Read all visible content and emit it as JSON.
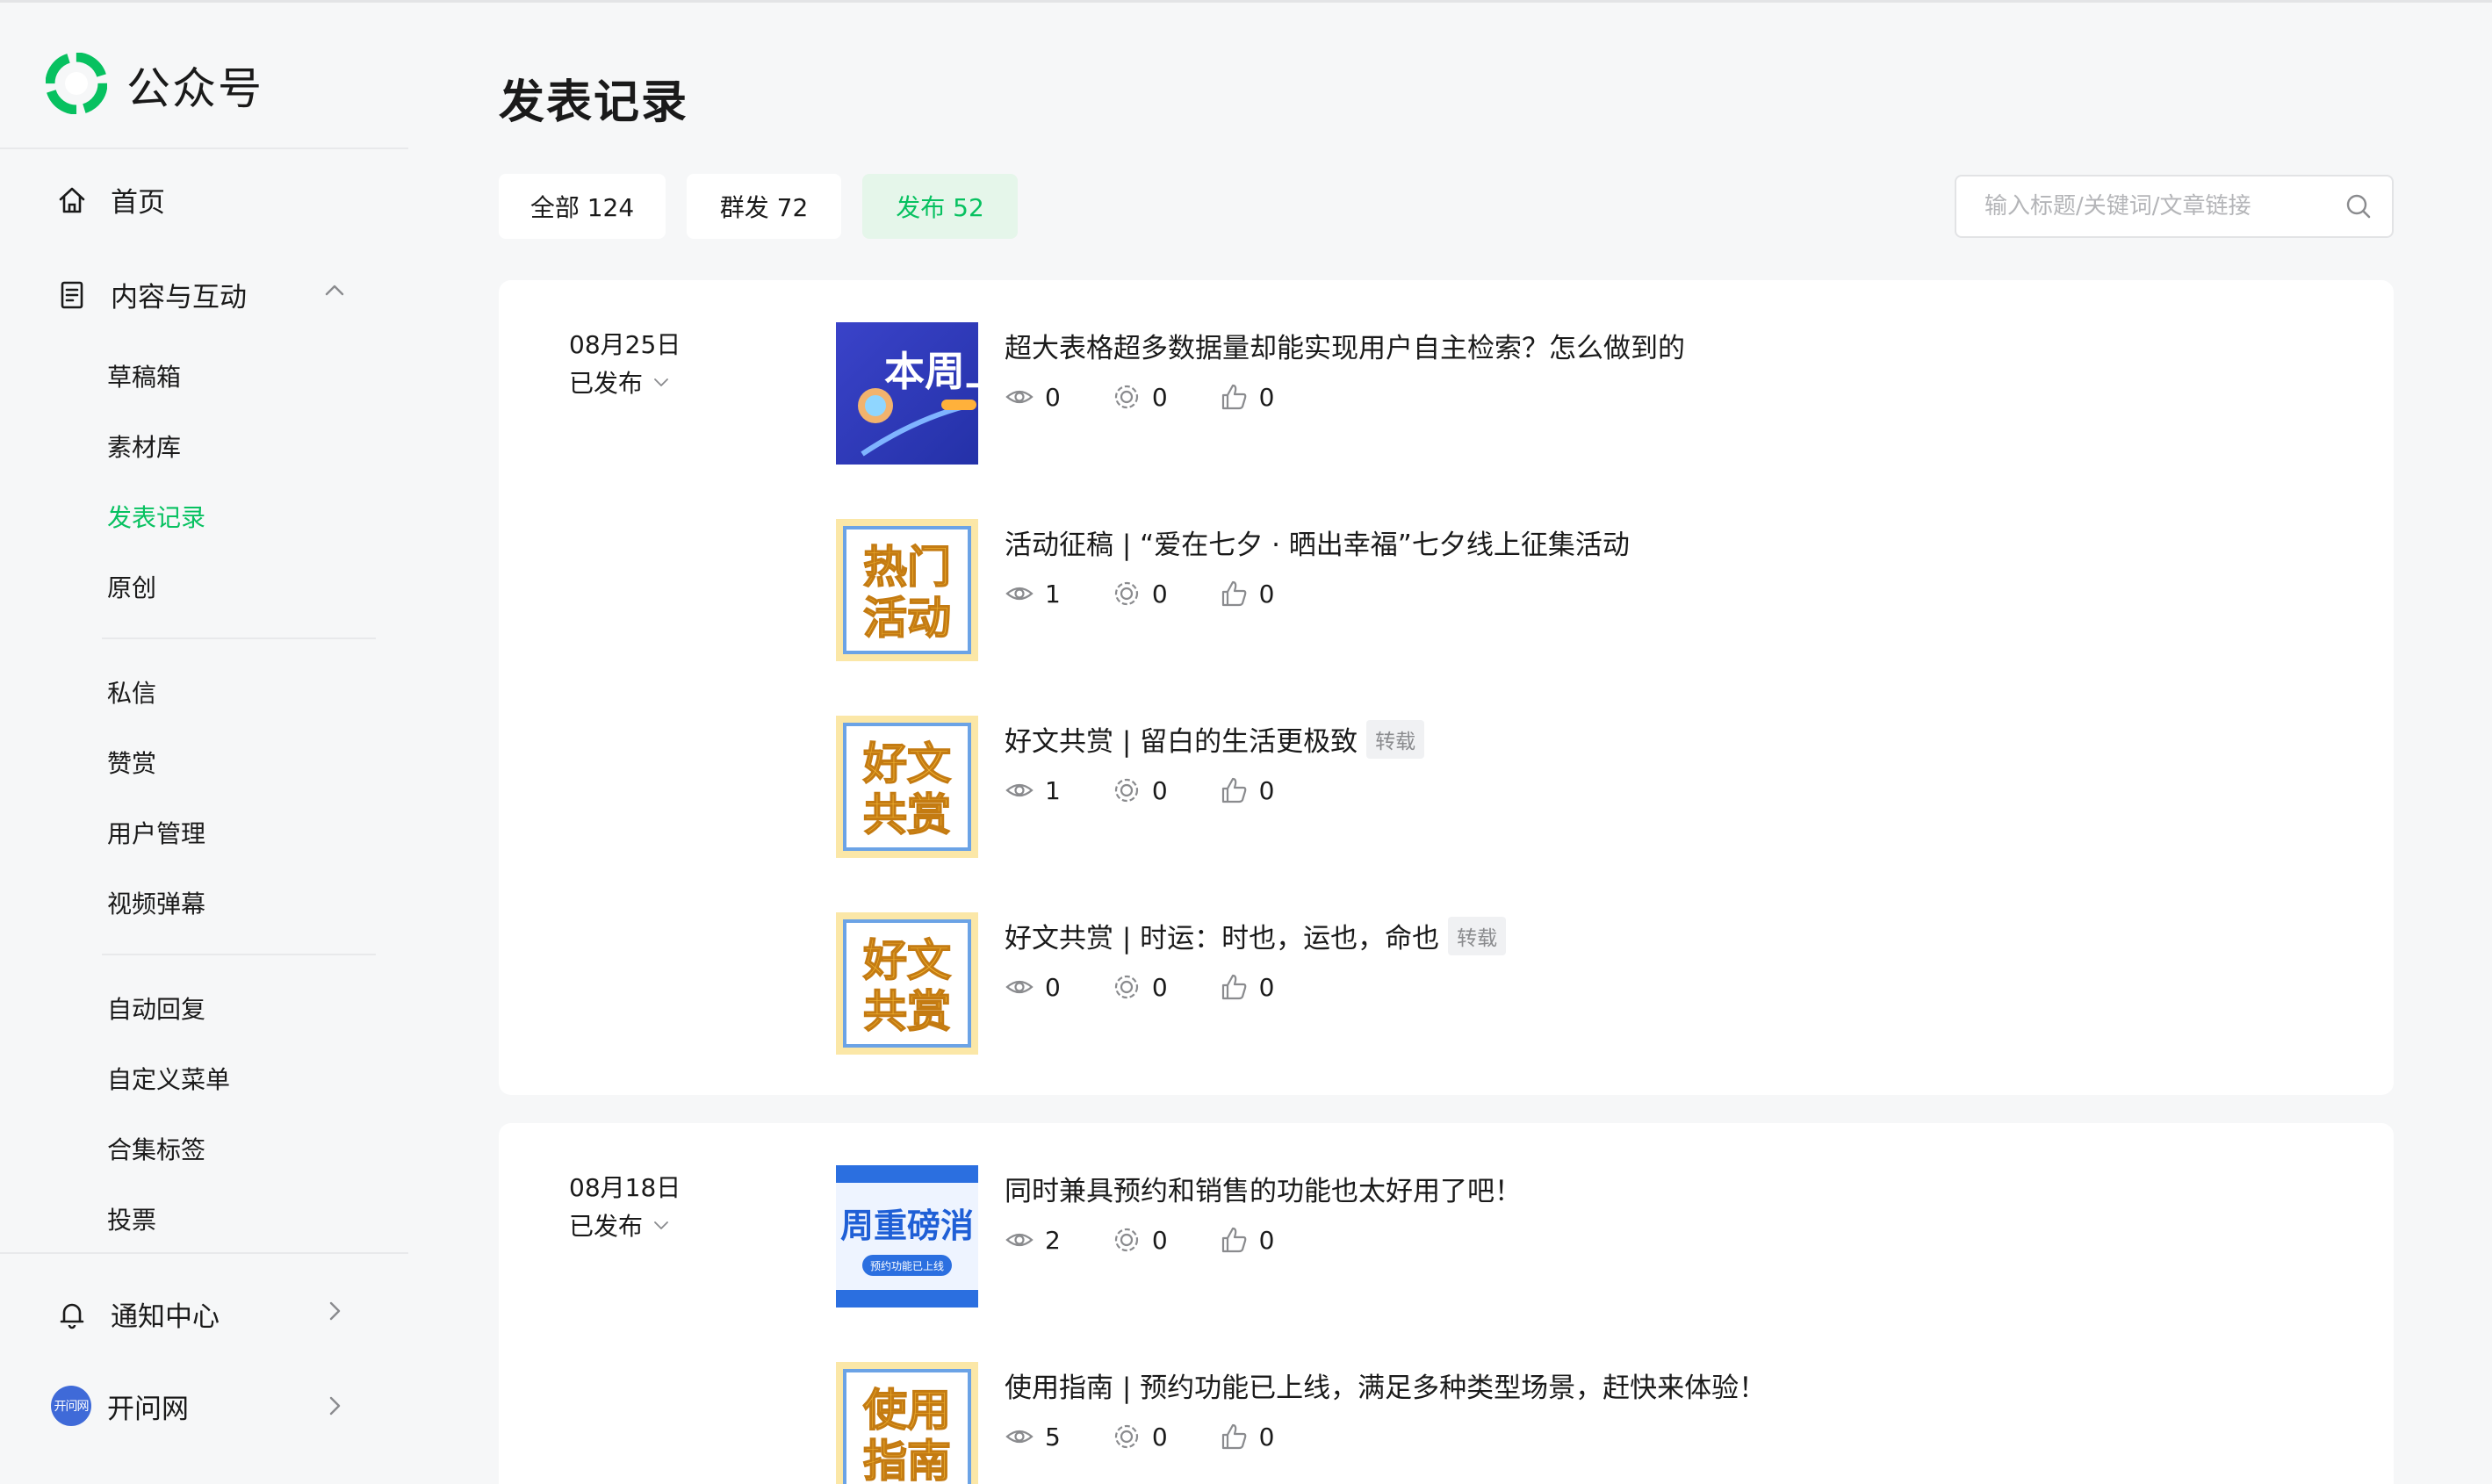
{
  "app": {
    "title": "公众号",
    "brand_color": "#07c160"
  },
  "sidebar": {
    "home": "首页",
    "content_group": "内容与互动",
    "sub_items_1": [
      "草稿箱",
      "素材库",
      "发表记录",
      "原创"
    ],
    "sub_items_2": [
      "私信",
      "赞赏",
      "用户管理",
      "视频弹幕"
    ],
    "sub_items_3": [
      "自动回复",
      "自定义菜单",
      "合集标签",
      "投票"
    ],
    "notifications": "通知中心",
    "account_name": "开问网",
    "account_avatar_text": "开问网"
  },
  "page": {
    "title": "发表记录"
  },
  "tabs": [
    {
      "label": "全部 124"
    },
    {
      "label": "群发 72"
    },
    {
      "label": "发布 52"
    }
  ],
  "search": {
    "placeholder": "输入标题/关键词/文章链接",
    "value": ""
  },
  "groups": [
    {
      "date": "08月25日",
      "status": "已发布",
      "articles": [
        {
          "title": "超大表格超多数据量却能实现用户自主检索？怎么做到的",
          "tag": "",
          "views": "0",
          "shares": "0",
          "likes": "0",
          "thumb": {
            "style": "blue",
            "line1": "本周上",
            "line2": ""
          }
        },
        {
          "title": "活动征稿 | “爱在七夕 · 晒出幸福”七夕线上征集活动",
          "tag": "",
          "views": "1",
          "shares": "0",
          "likes": "0",
          "thumb": {
            "style": "yellow",
            "line1": "热门",
            "line2": "活动"
          }
        },
        {
          "title": "好文共赏 | 留白的生活更极致",
          "tag": "转载",
          "views": "1",
          "shares": "0",
          "likes": "0",
          "thumb": {
            "style": "yellow",
            "line1": "好文",
            "line2": "共赏"
          }
        },
        {
          "title": "好文共赏 | 时运：时也，运也，命也",
          "tag": "转载",
          "views": "0",
          "shares": "0",
          "likes": "0",
          "thumb": {
            "style": "yellow",
            "line1": "好文",
            "line2": "共赏"
          }
        }
      ]
    },
    {
      "date": "08月18日",
      "status": "已发布",
      "articles": [
        {
          "title": "同时兼具预约和销售的功能也太好用了吧！",
          "tag": "",
          "views": "2",
          "shares": "0",
          "likes": "0",
          "thumb": {
            "style": "news",
            "line1": "周重磅消",
            "line2": "预约功能已上线"
          }
        },
        {
          "title": "使用指南 | 预约功能已上线，满足多种类型场景，赶快来体验！",
          "tag": "",
          "views": "5",
          "shares": "0",
          "likes": "0",
          "thumb": {
            "style": "yellow",
            "line1": "使用",
            "line2": "指南"
          }
        }
      ]
    }
  ]
}
